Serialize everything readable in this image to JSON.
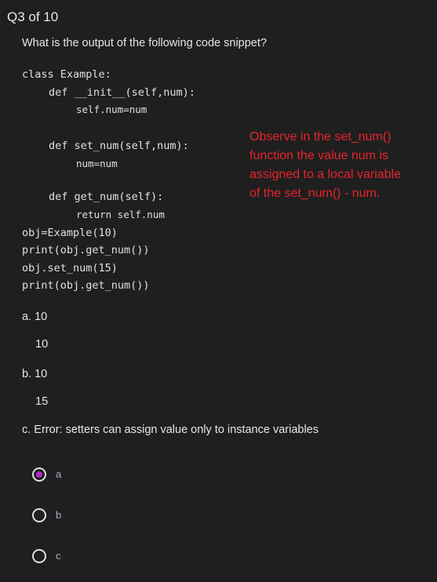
{
  "header": {
    "title": "Q3 of 10"
  },
  "question": {
    "prompt": "What is the output of the following code snippet?",
    "code": [
      "class Example:",
      "def __init__(self,num):",
      "self.num=num",
      "def set_num(self,num):",
      "num=num",
      "def get_num(self):",
      "return self.num",
      "obj=Example(10)",
      "print(obj.get_num())",
      "obj.set_num(15)",
      "print(obj.get_num())"
    ]
  },
  "annotation": [
    "Observe in the set_num()",
    "function the value num is",
    "assigned to a local variable",
    "of the set_num() - num."
  ],
  "options": {
    "a_line1": "a. 10",
    "a_line2": "10",
    "b_line1": "b. 10",
    "b_line2": "15",
    "c_line1": "c. Error: setters can assign value only to instance variables"
  },
  "answers": [
    {
      "label": "a",
      "selected": true
    },
    {
      "label": "b",
      "selected": false
    },
    {
      "label": "c",
      "selected": false
    }
  ],
  "colors": {
    "accent": "#b22bc8",
    "annotation": "#e8242c",
    "background": "#1f1f1f"
  }
}
